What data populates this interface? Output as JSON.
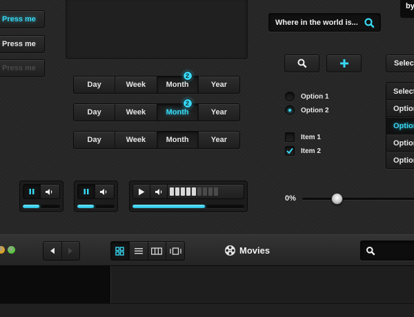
{
  "buttons": {
    "press_me_active": "Press me",
    "press_me": "Press me",
    "press_me_disabled": "Press me"
  },
  "segmented": {
    "rows": [
      {
        "items": [
          "Day",
          "Week",
          "Month",
          "Year"
        ],
        "selected": "Month",
        "badge": "2"
      },
      {
        "items": [
          "Day",
          "Week",
          "Month",
          "Year"
        ],
        "selected": "Month",
        "badge": "2"
      },
      {
        "items": [
          "Day",
          "Week",
          "Month",
          "Year"
        ],
        "selected": "Month",
        "badge": ""
      }
    ]
  },
  "search_top": {
    "placeholder": "Where in the world is..."
  },
  "tooltip": {
    "text": "by"
  },
  "select": {
    "label": "Select"
  },
  "dropdown": {
    "options": [
      "Select",
      "Option",
      "Option",
      "Option",
      "Option"
    ],
    "highlighted": 2
  },
  "radios": {
    "options": [
      "Option 1",
      "Option 2"
    ],
    "selected": 1
  },
  "checkboxes": {
    "items": [
      "Item 1",
      "Item 2"
    ],
    "checked": [
      false,
      true
    ]
  },
  "players": {
    "small_1": {
      "progress_fraction": 0.45
    },
    "small_2": {
      "progress_fraction": 0.45
    },
    "large": {
      "progress_fraction": 0.65,
      "volume_levels_on": 5,
      "volume_levels_total": 9
    }
  },
  "slider": {
    "value_label": "0%",
    "value": 0
  },
  "toolbar": {
    "title": "Movies",
    "traffic_colors": [
      "#e0a21f",
      "#58c93a"
    ]
  },
  "colors": {
    "accent": "#37d8f3",
    "background": "#262626"
  },
  "icons": {
    "search": "search-icon",
    "plus": "plus-icon",
    "pause": "pause-icon",
    "play": "play-icon",
    "volume": "volume-icon",
    "back": "chevron-left-icon",
    "forward": "chevron-right-icon",
    "film": "film-reel-icon"
  }
}
